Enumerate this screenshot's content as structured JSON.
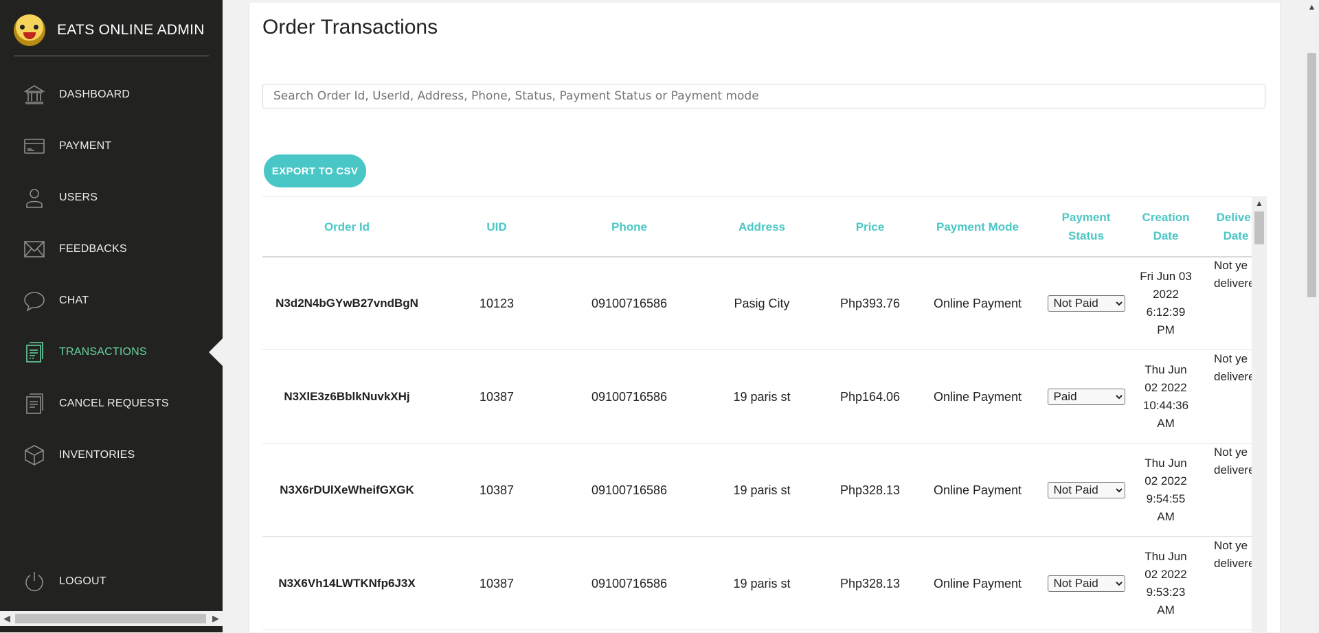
{
  "brand": {
    "title": "EATS ONLINE ADMIN"
  },
  "sidebar": {
    "items": [
      {
        "label": "DASHBOARD",
        "icon": "bank-icon"
      },
      {
        "label": "PAYMENT",
        "icon": "credit-card-icon"
      },
      {
        "label": "USERS",
        "icon": "user-icon"
      },
      {
        "label": "FEEDBACKS",
        "icon": "mail-icon"
      },
      {
        "label": "CHAT",
        "icon": "chat-bubble-icon"
      },
      {
        "label": "TRANSACTIONS",
        "icon": "receipt-icon",
        "active": true
      },
      {
        "label": "CANCEL REQUESTS",
        "icon": "document-icon"
      },
      {
        "label": "INVENTORIES",
        "icon": "box-icon"
      }
    ],
    "logout": {
      "label": "LOGOUT",
      "icon": "power-icon"
    }
  },
  "main": {
    "title": "Order Transactions",
    "search_placeholder": "Search Order Id, UserId, Address, Phone, Status, Payment Status or Payment mode",
    "export_label": "EXPORT TO CSV"
  },
  "table": {
    "headers": {
      "order_id": "Order Id",
      "uid": "UID",
      "phone": "Phone",
      "address": "Address",
      "price": "Price",
      "payment_mode": "Payment Mode",
      "payment_status_1": "Payment",
      "payment_status_2": "Status",
      "creation_date_1": "Creation",
      "creation_date_2": "Date",
      "delivery_date_1": "Deliver",
      "delivery_date_2": "Date"
    },
    "status_options": [
      "Not Paid",
      "Paid"
    ],
    "rows": [
      {
        "order_id": "N3d2N4bGYwB27vndBgN",
        "uid": "10123",
        "phone": "09100716586",
        "address": "Pasig City",
        "price": "Php393.76",
        "payment_mode": "Online Payment",
        "payment_status": "Not Paid",
        "created_1": "Fri Jun 03",
        "created_2": "2022",
        "created_3": "6:12:39",
        "created_4": "PM",
        "delivery_1": "Not ye",
        "delivery_2": "delivere"
      },
      {
        "order_id": "N3XlE3z6BblkNuvkXHj",
        "uid": "10387",
        "phone": "09100716586",
        "address": "19 paris st",
        "price": "Php164.06",
        "payment_mode": "Online Payment",
        "payment_status": "Paid",
        "created_1": "Thu Jun",
        "created_2": "02 2022",
        "created_3": "10:44:36",
        "created_4": "AM",
        "delivery_1": "Not ye",
        "delivery_2": "delivere"
      },
      {
        "order_id": "N3X6rDUlXeWheifGXGK",
        "uid": "10387",
        "phone": "09100716586",
        "address": "19 paris st",
        "price": "Php328.13",
        "payment_mode": "Online Payment",
        "payment_status": "Not Paid",
        "created_1": "Thu Jun",
        "created_2": "02 2022",
        "created_3": "9:54:55",
        "created_4": "AM",
        "delivery_1": "Not ye",
        "delivery_2": "delivere"
      },
      {
        "order_id": "N3X6Vh14LWTKNfp6J3X",
        "uid": "10387",
        "phone": "09100716586",
        "address": "19 paris st",
        "price": "Php328.13",
        "payment_mode": "Online Payment",
        "payment_status": "Not Paid",
        "created_1": "Thu Jun",
        "created_2": "02 2022",
        "created_3": "9:53:23",
        "created_4": "AM",
        "delivery_1": "Not ye",
        "delivery_2": "delivere"
      }
    ]
  }
}
